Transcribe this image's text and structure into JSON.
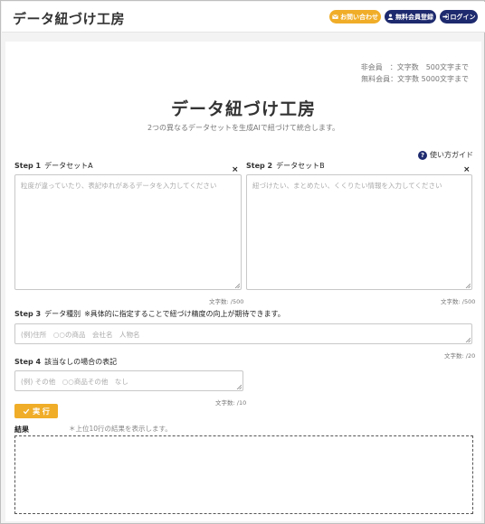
{
  "header": {
    "site_title": "データ紐づけ工房",
    "contact_label": "お問い合わせ",
    "register_label": "無料会員登録",
    "login_label": "ログイン"
  },
  "limits": {
    "non_member": "非会員　：文字数　500文字まで",
    "free_member": "無料会員：文字数 5000文字まで"
  },
  "main": {
    "title": "データ紐づけ工房",
    "subtitle": "2つの異なるデータセットを生成AIで紐づけて統合します。",
    "guide_label": "使い方ガイド",
    "guide_icon": "?"
  },
  "step1": {
    "step": "Step 1",
    "label": "データセットA",
    "placeholder": "粒度が違っていたり、表記ゆれがあるデータを入力してください",
    "count": "文字数: /500"
  },
  "step2": {
    "step": "Step 2",
    "label": "データセットB",
    "placeholder": "紐づけたい、まとめたい、くくりたい情報を入力してください",
    "count": "文字数: /500"
  },
  "step3": {
    "step": "Step 3",
    "label": "データ種別",
    "note": "※具体的に指定することで紐づけ精度の向上が期待できます。",
    "placeholder": "(例)住所　○○の商品　会社名　人物名",
    "count": "文字数: /20"
  },
  "step4": {
    "step": "Step 4",
    "label": "該当なしの場合の表記",
    "placeholder": "(例) その他　○○商品その他　なし",
    "count": "文字数: /10"
  },
  "run_label": "実 行",
  "result": {
    "label": "結果",
    "note": "＊上位10行の結果を表示します。"
  },
  "close_symbol": "×",
  "colors": {
    "accent_orange": "#f0ad28",
    "navy": "#1e2a6e"
  }
}
